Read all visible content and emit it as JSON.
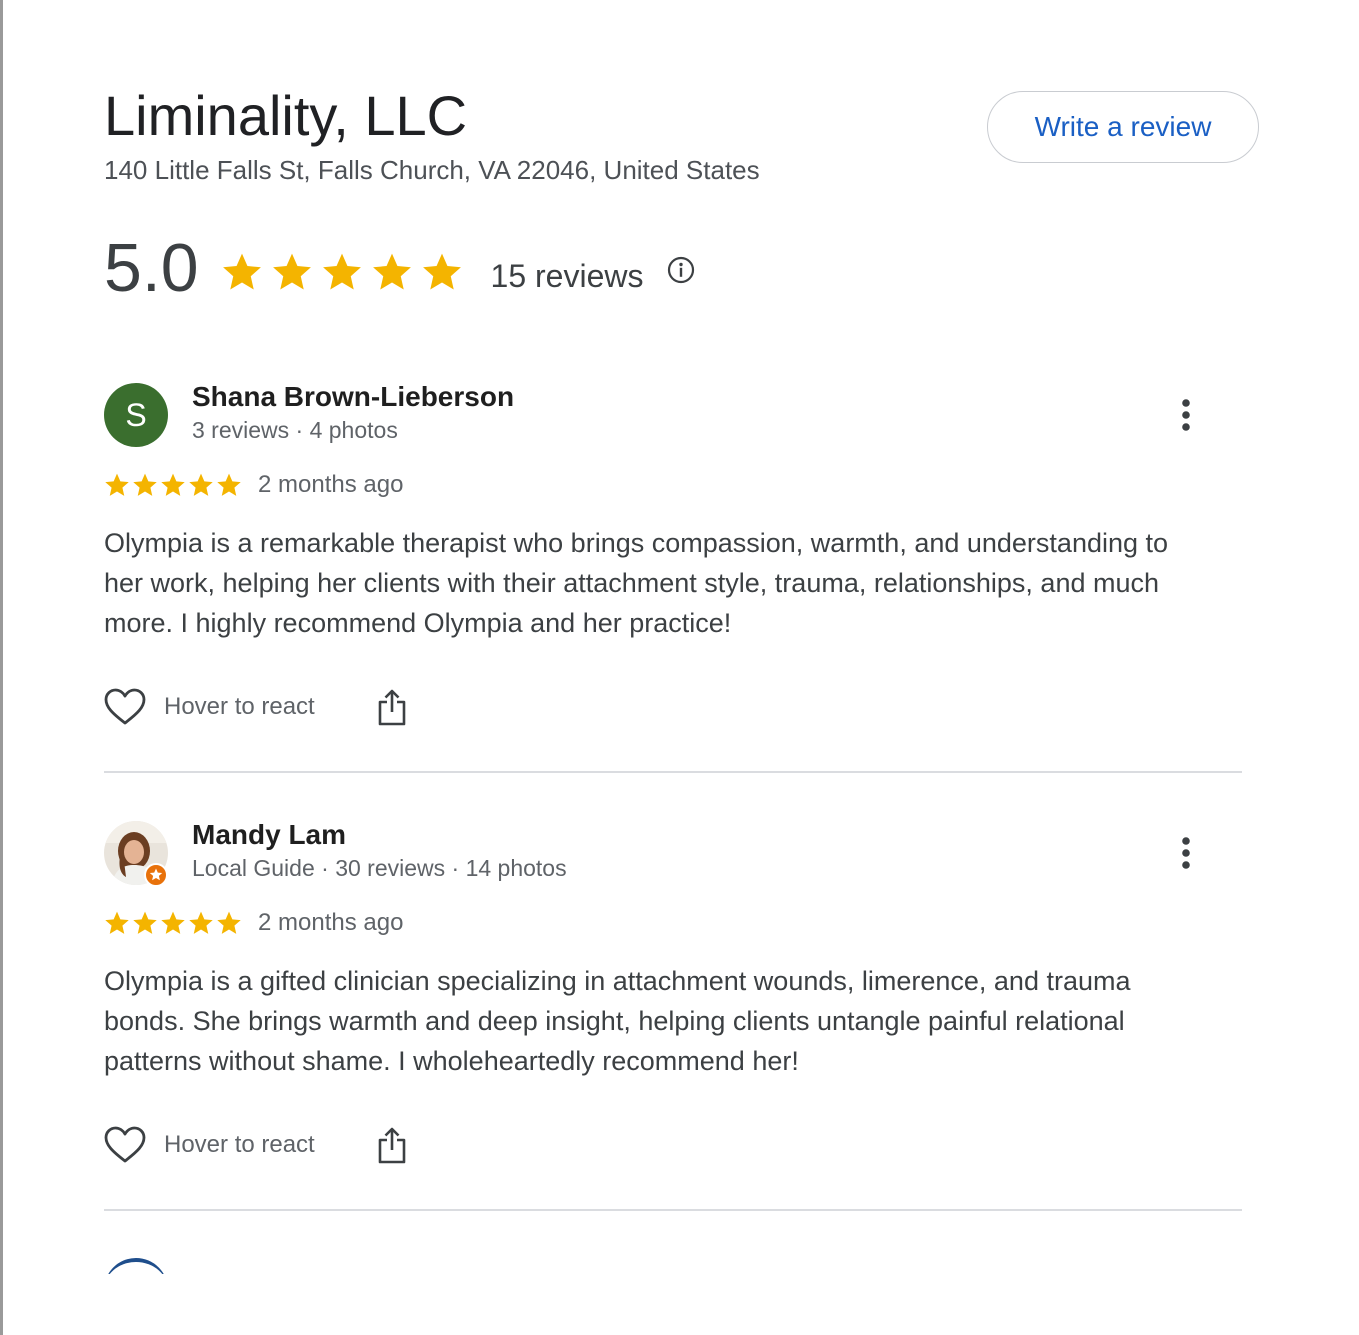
{
  "business": {
    "name": "Liminality, LLC",
    "address": "140 Little Falls St, Falls Church, VA 22046, United States",
    "write_review_label": "Write a review"
  },
  "summary": {
    "rating": "5.0",
    "stars": 5,
    "review_count_text": "15 reviews",
    "info_icon": "info-icon"
  },
  "colors": {
    "star": "#f4b400",
    "link_blue": "#1a5fc4",
    "avatar_green": "#3a6e2e",
    "divider": "#dadce0"
  },
  "reviews": [
    {
      "name": "Shana Brown-Lieberson",
      "avatar_letter": "S",
      "meta": "3 reviews · 4 photos",
      "stars": 5,
      "date": "2 months ago",
      "text": "Olympia is a remarkable therapist who brings compassion, warmth, and understanding to her work, helping her clients with their attachment style, trauma, relationships, and much more. I highly recommend Olympia and her practice!",
      "react_label": "Hover to react"
    },
    {
      "name": "Mandy Lam",
      "avatar_letter": "",
      "meta": "Local Guide · 30 reviews · 14 photos",
      "stars": 5,
      "date": "2 months ago",
      "text": "Olympia is a gifted clinician specializing in attachment wounds, limerence, and trauma bonds. She brings warmth and deep insight, helping clients untangle painful relational patterns without shame. I wholeheartedly recommend her!",
      "react_label": "Hover to react"
    }
  ]
}
